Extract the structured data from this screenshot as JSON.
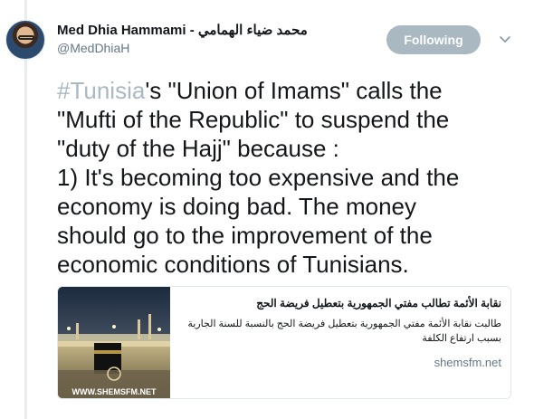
{
  "user": {
    "display_name": "Med Dhia Hammami - محمد ضياء الهمامي",
    "handle": "@MedDhiaH",
    "follow_button": "Following"
  },
  "tweet": {
    "hashtag": "#Tunisia",
    "lines": [
      "'s \"Union of Imams\" calls the",
      "\"Mufti of the Republic\" to suspend the",
      "\"duty of the Hajj\" because :",
      "1) It's becoming too expensive and the",
      "economy is doing bad. The money",
      "should go to the improvement of the",
      "economic conditions of Tunisians."
    ]
  },
  "card": {
    "title": "نقابة الأئمة تطالب مفتي الجمهورية بتعطيل فريضة الحج",
    "description": "طالبت نقابة الأئمة  مفتي الجمهورية بتعطيل فريضة الحج بالنسبة للسنة الجارية بسبب ارتفاع  الكلفة",
    "domain": "shemsfm.net",
    "thumbnail_watermark": "WWW.SHEMSFM.NET"
  },
  "colors": {
    "follow_button_bg": "#aab8c2",
    "hashtag": "#aab8c2",
    "secondary_text": "#657786"
  },
  "icons": {
    "menu": "chevron-down-icon"
  }
}
